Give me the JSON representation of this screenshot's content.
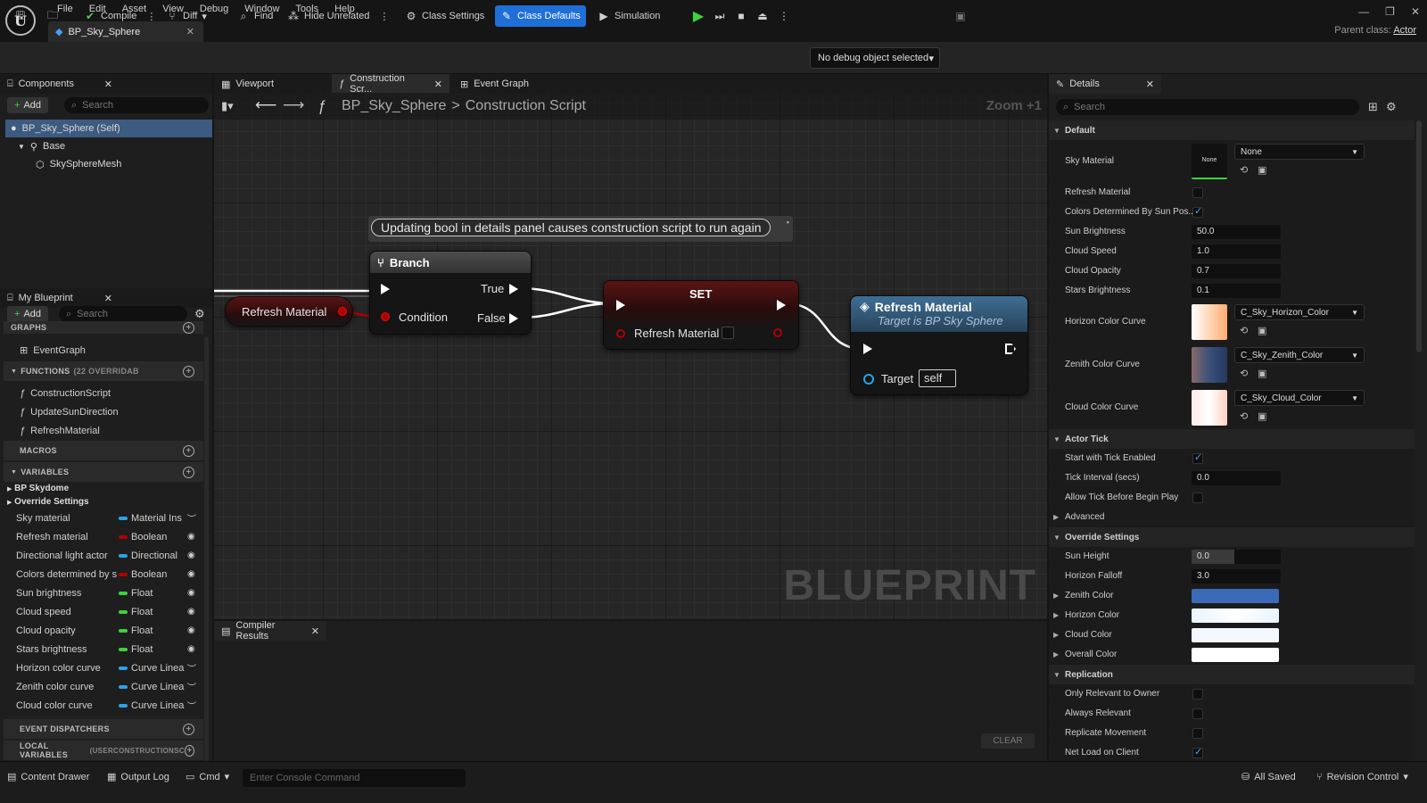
{
  "menu": [
    "File",
    "Edit",
    "Asset",
    "View",
    "Debug",
    "Window",
    "Tools",
    "Help"
  ],
  "doc_tab": {
    "title": "BP_Sky_Sphere"
  },
  "parent_class": {
    "label": "Parent class:",
    "value": "Actor"
  },
  "toolbar": {
    "compile": "Compile",
    "diff": "Diff",
    "find": "Find",
    "hide_unrelated": "Hide Unrelated",
    "class_settings": "Class Settings",
    "class_defaults": "Class Defaults",
    "simulation": "Simulation",
    "debug_object": "No debug object selected"
  },
  "components": {
    "tab": "Components",
    "add": "Add",
    "search_placeholder": "Search",
    "items": [
      "BP_Sky_Sphere (Self)",
      "Base",
      "SkySphereMesh"
    ]
  },
  "my_blueprint": {
    "tab": "My Blueprint",
    "add": "Add",
    "search_placeholder": "Search",
    "graphs_label": "GRAPHS",
    "graphs": [
      "EventGraph"
    ],
    "functions_label": "FUNCTIONS",
    "functions_note": "(22 OVERRIDAB",
    "functions": [
      "ConstructionScript",
      "UpdateSunDirection",
      "RefreshMaterial"
    ],
    "macros_label": "MACROS",
    "variables_label": "VARIABLES",
    "var_groups": [
      "BP Skydome",
      "Override Settings"
    ],
    "variables": [
      {
        "name": "Sky material",
        "type": "Material Ins",
        "color": "#2aa3e8"
      },
      {
        "name": "Refresh material",
        "type": "Boolean",
        "color": "#b00000"
      },
      {
        "name": "Directional light actor",
        "type": "Directional",
        "color": "#2aa3e8"
      },
      {
        "name": "Colors determined by s",
        "type": "Boolean",
        "color": "#b00000"
      },
      {
        "name": "Sun brightness",
        "type": "Float",
        "color": "#3cd33c"
      },
      {
        "name": "Cloud speed",
        "type": "Float",
        "color": "#3cd33c"
      },
      {
        "name": "Cloud opacity",
        "type": "Float",
        "color": "#3cd33c"
      },
      {
        "name": "Stars brightness",
        "type": "Float",
        "color": "#3cd33c"
      },
      {
        "name": "Horizon color curve",
        "type": "Curve Linea",
        "color": "#2aa3e8"
      },
      {
        "name": "Zenith color curve",
        "type": "Curve Linea",
        "color": "#2aa3e8"
      },
      {
        "name": "Cloud color curve",
        "type": "Curve Linea",
        "color": "#2aa3e8"
      }
    ],
    "event_dispatchers_label": "EVENT DISPATCHERS",
    "local_variables_label": "LOCAL VARIABLES",
    "local_variables_note": "(USERCONSTRUCTIONSC"
  },
  "graph_tabs": [
    "Viewport",
    "Construction Scr...",
    "Event Graph"
  ],
  "breadcrumb": {
    "root": "BP_Sky_Sphere",
    "sep": ">",
    "current": "Construction Script"
  },
  "zoom": "Zoom +1",
  "watermark": "BLUEPRINT",
  "comment": "Updating bool in details panel causes construction script to run again",
  "nodes": {
    "var_get": "Refresh Material",
    "branch": {
      "title": "Branch",
      "condition": "Condition",
      "true": "True",
      "false": "False"
    },
    "set": {
      "title": "SET",
      "pin": "Refresh Material"
    },
    "call": {
      "title": "Refresh Material",
      "subtitle": "Target is BP Sky Sphere",
      "target": "Target",
      "self": "self"
    }
  },
  "compiler": {
    "tab": "Compiler Results",
    "clear": "CLEAR"
  },
  "details": {
    "tab": "Details",
    "search_placeholder": "Search",
    "default_section": "Default",
    "sky_material": {
      "label": "Sky Material",
      "thumb": "None",
      "value": "None"
    },
    "refresh_material": "Refresh Material",
    "colors_determined": "Colors Determined By Sun Pos...",
    "sun_brightness": {
      "label": "Sun Brightness",
      "value": "50.0"
    },
    "cloud_speed": {
      "label": "Cloud Speed",
      "value": "1.0"
    },
    "cloud_opacity": {
      "label": "Cloud Opacity",
      "value": "0.7"
    },
    "stars_brightness": {
      "label": "Stars Brightness",
      "value": "0.1"
    },
    "horizon_curve": {
      "label": "Horizon Color Curve",
      "value": "C_Sky_Horizon_Color"
    },
    "zenith_curve": {
      "label": "Zenith Color Curve",
      "value": "C_Sky_Zenith_Color"
    },
    "cloud_curve": {
      "label": "Cloud Color Curve",
      "value": "C_Sky_Cloud_Color"
    },
    "actor_tick_section": "Actor Tick",
    "start_tick": "Start with Tick Enabled",
    "tick_interval": {
      "label": "Tick Interval (secs)",
      "value": "0.0"
    },
    "allow_tick": "Allow Tick Before Begin Play",
    "advanced": "Advanced",
    "override_section": "Override Settings",
    "sun_height": {
      "label": "Sun Height",
      "value": "0.0"
    },
    "horizon_falloff": {
      "label": "Horizon Falloff",
      "value": "3.0"
    },
    "zenith_color": "Zenith Color",
    "horizon_color": "Horizon Color",
    "cloud_color": "Cloud Color",
    "overall_color": "Overall Color",
    "replication_section": "Replication",
    "only_relevant": "Only Relevant to Owner",
    "always_relevant": "Always Relevant",
    "replicate_movement": "Replicate Movement",
    "net_load": "Net Load on Client"
  },
  "statusbar": {
    "content_drawer": "Content Drawer",
    "output_log": "Output Log",
    "cmd": "Cmd",
    "console_placeholder": "Enter Console Command",
    "all_saved": "All Saved",
    "revision_control": "Revision Control"
  }
}
